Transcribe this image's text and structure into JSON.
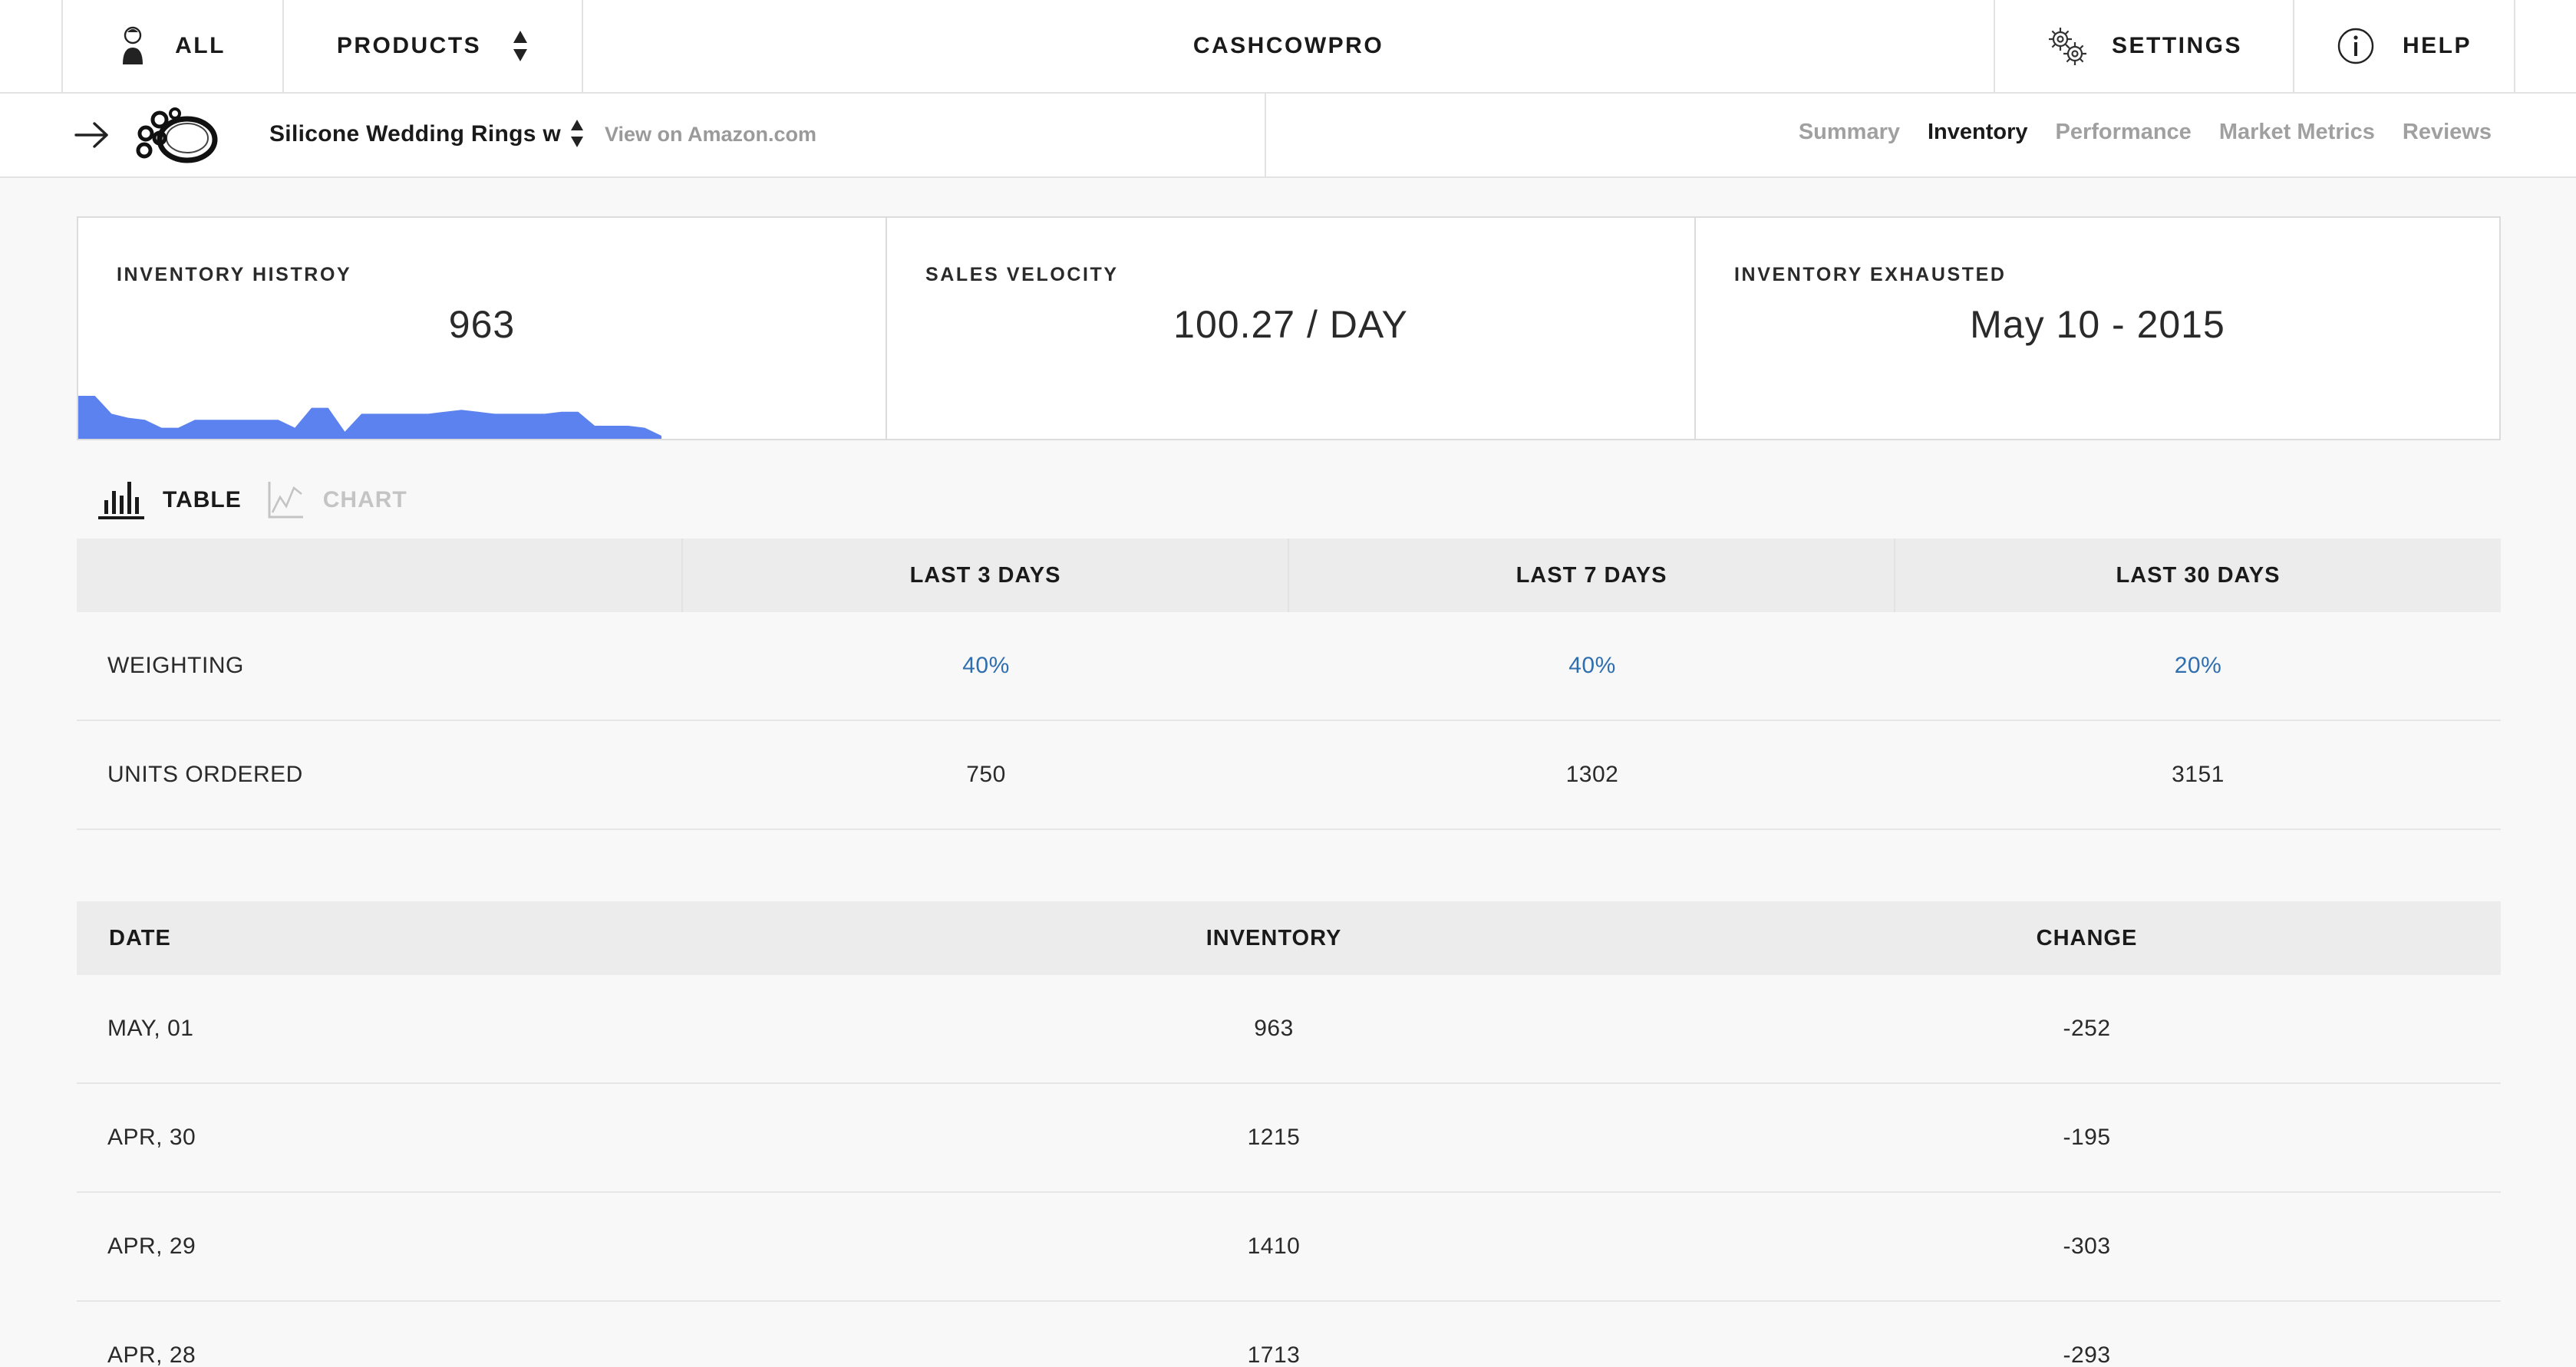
{
  "topnav": {
    "all_label": "ALL",
    "products_label": "PRODUCTS",
    "brand": "CASHCOWPRO",
    "settings_label": "SETTINGS",
    "help_label": "HELP"
  },
  "subnav": {
    "product_title": "Silicone Wedding Rings w",
    "amazon_link": "View on Amazon.com",
    "tabs": [
      {
        "label": "Summary",
        "active": false
      },
      {
        "label": "Inventory",
        "active": true
      },
      {
        "label": "Performance",
        "active": false
      },
      {
        "label": "Market Metrics",
        "active": false
      },
      {
        "label": "Reviews",
        "active": false
      }
    ]
  },
  "cards": {
    "inventory_history": {
      "label": "INVENTORY HISTROY",
      "value": "963"
    },
    "sales_velocity": {
      "label": "SALES VELOCITY",
      "value": "100.27 / DAY"
    },
    "inventory_exhausted": {
      "label": "INVENTORY EXHAUSTED",
      "value": "May 10 - 2015"
    }
  },
  "sparkline": {
    "color": "#5b82ee",
    "values": [
      1.0,
      1.0,
      0.55,
      0.45,
      0.4,
      0.2,
      0.2,
      0.4,
      0.4,
      0.4,
      0.4,
      0.4,
      0.4,
      0.2,
      0.7,
      0.7,
      0.1,
      0.55,
      0.55,
      0.55,
      0.55,
      0.55,
      0.6,
      0.65,
      0.6,
      0.55,
      0.55,
      0.55,
      0.55,
      0.6,
      0.6,
      0.25,
      0.25,
      0.25,
      0.2,
      0.0
    ]
  },
  "toggle": {
    "table_label": "TABLE",
    "chart_label": "CHART"
  },
  "velocity_table": {
    "headers": [
      "",
      "LAST 3 DAYS",
      "LAST 7 DAYS",
      "LAST 30 DAYS"
    ],
    "rows": [
      [
        "WEIGHTING",
        "40%",
        "40%",
        "20%"
      ],
      [
        "UNITS ORDERED",
        "750",
        "1302",
        "3151"
      ]
    ]
  },
  "inventory_table": {
    "headers": [
      "DATE",
      "INVENTORY",
      "CHANGE"
    ],
    "rows": [
      [
        "MAY, 01",
        "963",
        "-252"
      ],
      [
        "APR, 30",
        "1215",
        "-195"
      ],
      [
        "APR, 29",
        "1410",
        "-303"
      ],
      [
        "APR, 28",
        "1713",
        "-293"
      ]
    ]
  },
  "colors": {
    "accent_blue": "#2f6fb0",
    "sparkline": "#5b82ee",
    "header_bg": "#ececed"
  }
}
